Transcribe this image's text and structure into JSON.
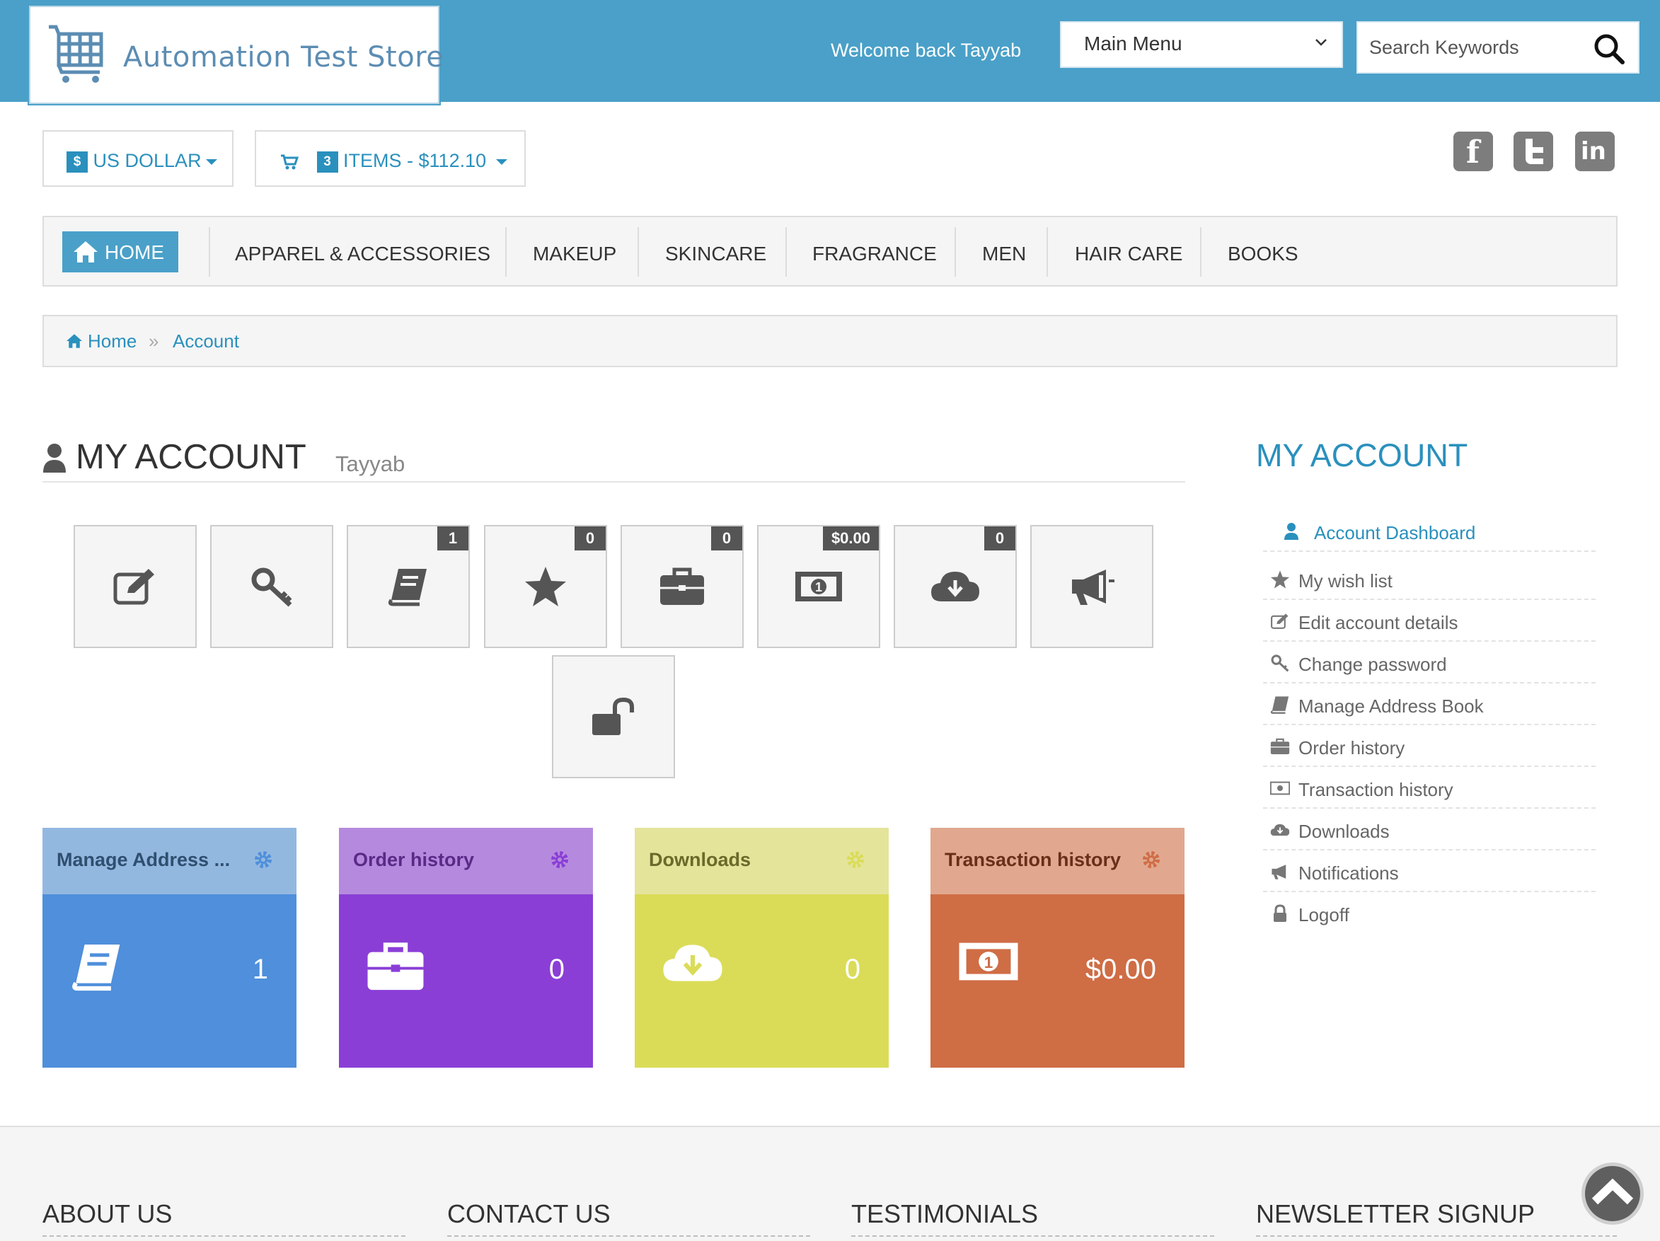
{
  "header": {
    "store_name": "Automation Test Store",
    "welcome": "Welcome back Tayyab",
    "main_menu_selected": "Main Menu",
    "search_placeholder": "Search Keywords",
    "colors": {
      "brand": "#4aa0c8",
      "link": "#2a90bd"
    }
  },
  "toolbar": {
    "currency_symbol": "$",
    "currency_label": "US DOLLAR",
    "cart_count": "3",
    "cart_label": "ITEMS - $112.10"
  },
  "social": [
    "facebook-icon",
    "twitter-icon",
    "linkedin-icon"
  ],
  "nav": {
    "home": "HOME",
    "items": [
      "APPAREL & ACCESSORIES",
      "MAKEUP",
      "SKINCARE",
      "FRAGRANCE",
      "MEN",
      "HAIR CARE",
      "BOOKS"
    ]
  },
  "breadcrumb": {
    "home": "Home",
    "current": "Account"
  },
  "account": {
    "title": "MY ACCOUNT",
    "username": "Tayyab",
    "tiles": [
      {
        "icon": "edit-icon",
        "count": ""
      },
      {
        "icon": "key-icon",
        "count": ""
      },
      {
        "icon": "address-book-icon",
        "count": "1"
      },
      {
        "icon": "star-icon",
        "count": "0"
      },
      {
        "icon": "briefcase-icon",
        "count": "0"
      },
      {
        "icon": "money-icon",
        "count": "$0.00"
      },
      {
        "icon": "cloud-download-icon",
        "count": "0"
      },
      {
        "icon": "megaphone-icon",
        "count": ""
      },
      {
        "icon": "unlock-icon",
        "count": ""
      }
    ]
  },
  "dashboard": [
    {
      "title": "Manage Address ...",
      "value": "1",
      "icon": "address-book-icon",
      "head_color": "#93b8e0",
      "body_color": "#4f8fdb",
      "head_text": "#2f4f6f"
    },
    {
      "title": "Order history",
      "value": "0",
      "icon": "briefcase-icon",
      "head_color": "#b58ade",
      "body_color": "#8a3ed6",
      "head_text": "#5a2a86"
    },
    {
      "title": "Downloads",
      "value": "0",
      "icon": "cloud-download-icon",
      "head_color": "#e4e49b",
      "body_color": "#dadc58",
      "head_text": "#6a6a2a"
    },
    {
      "title": "Transaction history",
      "value": "$0.00",
      "icon": "money-icon",
      "head_color": "#e1a88f",
      "body_color": "#cf6d45",
      "head_text": "#6a2f18"
    }
  ],
  "sidebar": {
    "title": "MY ACCOUNT",
    "items": [
      {
        "label": "Account Dashboard",
        "icon": "user-icon"
      },
      {
        "label": "My wish list",
        "icon": "star-icon"
      },
      {
        "label": "Edit account details",
        "icon": "edit-icon"
      },
      {
        "label": "Change password",
        "icon": "key-icon"
      },
      {
        "label": "Manage Address Book",
        "icon": "address-book-icon"
      },
      {
        "label": "Order history",
        "icon": "briefcase-icon"
      },
      {
        "label": "Transaction history",
        "icon": "money-icon"
      },
      {
        "label": "Downloads",
        "icon": "cloud-download-icon"
      },
      {
        "label": "Notifications",
        "icon": "megaphone-icon"
      },
      {
        "label": "Logoff",
        "icon": "lock-icon"
      }
    ]
  },
  "footer": {
    "headings": [
      "ABOUT US",
      "CONTACT US",
      "TESTIMONIALS",
      "NEWSLETTER SIGNUP"
    ]
  }
}
